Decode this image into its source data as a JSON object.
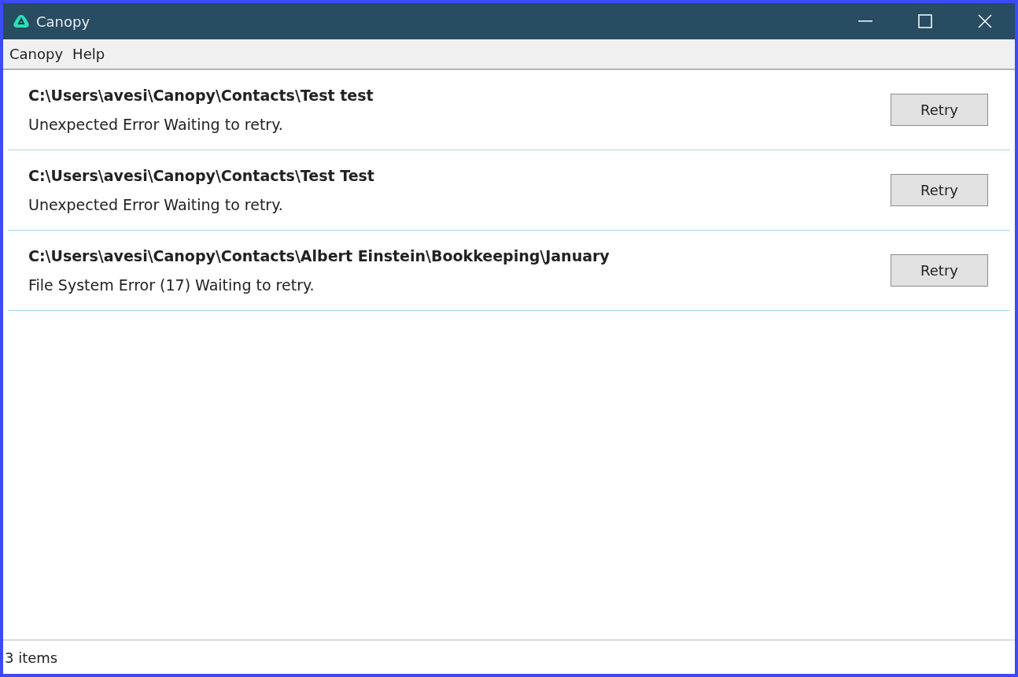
{
  "window": {
    "title": "Canopy"
  },
  "menu": [
    "Canopy",
    "Help"
  ],
  "items": [
    {
      "path": "C:\\Users\\avesi\\Canopy\\Contacts\\Test test",
      "status": "Unexpected Error Waiting to retry.",
      "button": "Retry"
    },
    {
      "path": "C:\\Users\\avesi\\Canopy\\Contacts\\Test Test",
      "status": "Unexpected Error Waiting to retry.",
      "button": "Retry"
    },
    {
      "path": "C:\\Users\\avesi\\Canopy\\Contacts\\Albert Einstein\\Bookkeeping\\January",
      "status": "File System Error (17) Waiting to retry.",
      "button": "Retry"
    }
  ],
  "status_bar": "3 items"
}
